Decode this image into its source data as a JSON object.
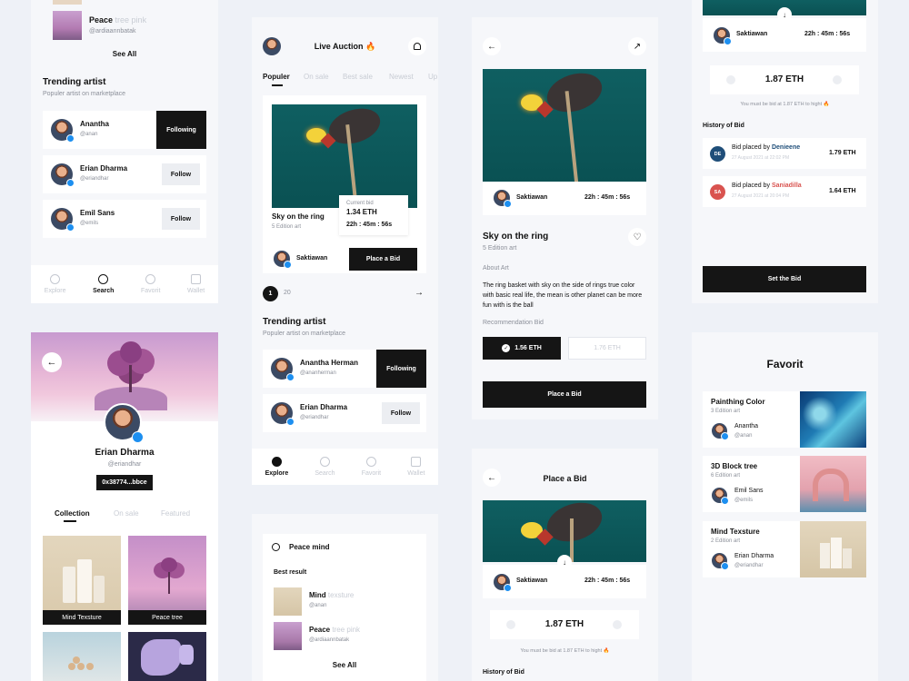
{
  "p1": {
    "peace_title": "Peace",
    "peace_sub": "tree pink",
    "peace_user": "@ardiaannbatak",
    "see_all": "See All",
    "trending": "Trending artist",
    "trending_sub": "Populer artist on marketplace",
    "artists": [
      {
        "name": "Anantha",
        "handle": "@anan",
        "btn": "Following"
      },
      {
        "name": "Erian Dharma",
        "handle": "@eriandhar",
        "btn": "Follow"
      },
      {
        "name": "Emil Sans",
        "handle": "@emils",
        "btn": "Follow"
      }
    ],
    "nav": [
      "Explore",
      "Search",
      "Favorit",
      "Wallet"
    ]
  },
  "p2": {
    "name": "Erian Dharma",
    "handle": "@eriandhar",
    "wallet": "0x38774...bbce",
    "tabs": [
      "Collection",
      "On sale",
      "Featured"
    ],
    "items": [
      "Mind Texsture",
      "Peace tree"
    ]
  },
  "p3": {
    "title": "Live Auction",
    "tabs": [
      "Populer",
      "On sale",
      "Best sale",
      "Newest",
      "Up"
    ],
    "art_title": "Sky on the ring",
    "art_sub": "5 Edition art",
    "bid_label": "Current bid",
    "bid_value": "1.34 ETH",
    "timer": "22h : 45m : 56s",
    "owner": "Saktiawan",
    "place_bid": "Place a Bid",
    "page_current": "1",
    "page_total": "20",
    "trending": "Trending artist",
    "trending_sub": "Populer artist on marketplace",
    "artists": [
      {
        "name": "Anantha Herman",
        "handle": "@ananherman",
        "btn": "Following"
      },
      {
        "name": "Erian Dharma",
        "handle": "@eriandhar",
        "btn": "Follow"
      }
    ],
    "nav": [
      "Explore",
      "Search",
      "Favorit",
      "Wallet"
    ]
  },
  "p4": {
    "query": "Peace mind",
    "best": "Best result",
    "results": [
      {
        "title": "Mind",
        "sub": "texsture",
        "user": "@anan"
      },
      {
        "title": "Peace",
        "sub": "tree pink",
        "user": "@ardiaannbatak"
      }
    ],
    "see_all": "See All"
  },
  "p5": {
    "owner": "Saktiawan",
    "timer": "22h : 45m : 56s",
    "title": "Sky on the ring",
    "sub": "5 Edition art",
    "about_label": "About Art",
    "about": "The ring basket with sky on the side of rings true color with basic real life, the mean is other planet can be more fun with is the ball",
    "rec_label": "Recommendation Bid",
    "rec1": "1.56 ETH",
    "rec2": "1.76 ETH",
    "place_bid": "Place a Bid"
  },
  "p6": {
    "title": "Place a Bid",
    "owner": "Saktiawan",
    "timer": "22h : 45m : 56s",
    "amount": "1.87 ETH",
    "note": "You must be bid at 1.87 ETH to hight",
    "history": "History of Bid"
  },
  "p7": {
    "owner": "Saktiawan",
    "timer": "22h : 45m : 56s",
    "amount": "1.87 ETH",
    "note": "You must be bid at 1.87 ETH to hight",
    "history": "History of Bid",
    "bids": [
      {
        "initials": "DE",
        "prefix": "Bid placed by",
        "name": "Denieene",
        "date": "27 August 2021 at 22:02 PM",
        "value": "1.79 ETH",
        "color": "#1f4e79"
      },
      {
        "initials": "SA",
        "prefix": "Bid placed by",
        "name": "Saniadilla",
        "date": "27 August 2021 at 20:04 PM",
        "value": "1.64 ETH",
        "color": "#d9534f"
      }
    ],
    "set_bid": "Set the Bid"
  },
  "p8": {
    "title": "Favorit",
    "items": [
      {
        "title": "Painthing Color",
        "sub": "3 Edition art",
        "user": "Anantha",
        "handle": "@anan"
      },
      {
        "title": "3D Block tree",
        "sub": "6 Edition art",
        "user": "Emil Sans",
        "handle": "@emils"
      },
      {
        "title": "Mind Texsture",
        "sub": "2 Edition art",
        "user": "Erian Dharma",
        "handle": "@eriandhar"
      }
    ]
  }
}
